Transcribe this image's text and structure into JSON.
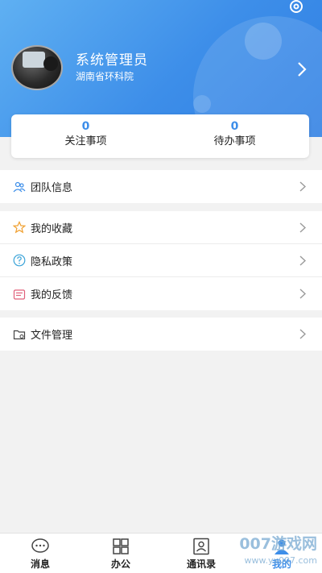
{
  "profile": {
    "name": "系统管理员",
    "org": "湖南省环科院"
  },
  "stats": [
    {
      "count": "0",
      "label": "关注事项"
    },
    {
      "count": "0",
      "label": "待办事项"
    }
  ],
  "menu": {
    "team": {
      "label": "团队信息"
    },
    "favorites": {
      "label": "我的收藏"
    },
    "privacy": {
      "label": "隐私政策"
    },
    "feedback": {
      "label": "我的反馈"
    },
    "files": {
      "label": "文件管理"
    }
  },
  "tabs": [
    {
      "label": "消息",
      "icon": "chat-icon"
    },
    {
      "label": "办公",
      "icon": "grid-icon"
    },
    {
      "label": "通讯录",
      "icon": "contacts-icon"
    },
    {
      "label": "我的",
      "icon": "person-icon",
      "active": true
    }
  ],
  "watermark": {
    "brand": "007游戏网",
    "url": "www.yx007.com"
  },
  "colors": {
    "accent": "#3d8ee9"
  }
}
